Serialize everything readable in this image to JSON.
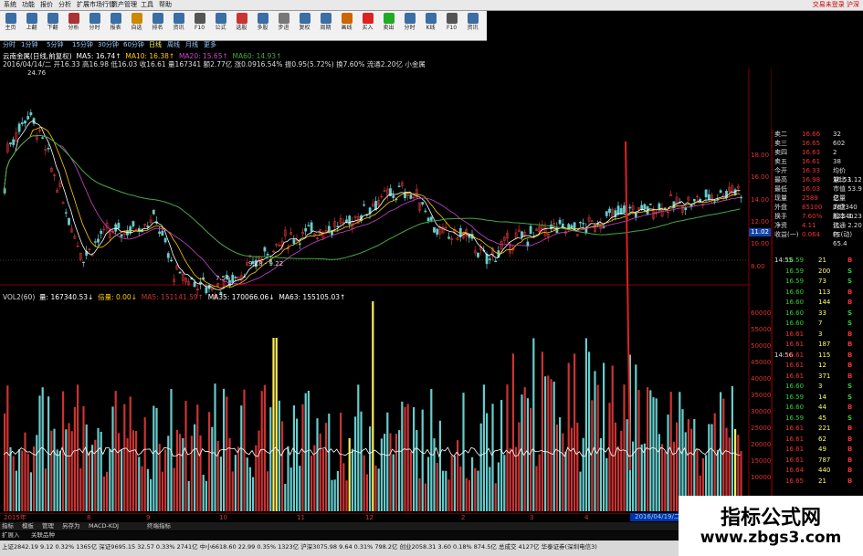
{
  "menu": {
    "items": [
      "系统",
      "功能",
      "报价",
      "分析",
      "扩展市场行情",
      "资产管理",
      "工具",
      "帮助"
    ],
    "right_text": "交易未登录  沪深"
  },
  "toolbar": {
    "buttons": [
      {
        "label": "主页",
        "icon": "home-icon",
        "color": "#3a6ea5"
      },
      {
        "label": "上翻",
        "icon": "up-arrow-icon",
        "color": "#3a6ea5"
      },
      {
        "label": "下翻",
        "icon": "down-arrow-icon",
        "color": "#3a6ea5"
      },
      {
        "label": "分析",
        "icon": "chart-icon",
        "color": "#a33"
      },
      {
        "label": "分时",
        "icon": "clock-icon",
        "color": "#3a6ea5"
      },
      {
        "label": "报表",
        "icon": "table-icon",
        "color": "#3a6ea5"
      },
      {
        "label": "自选",
        "icon": "star-icon",
        "color": "#c80"
      },
      {
        "label": "排名",
        "icon": "rank-icon",
        "color": "#3a6ea5"
      },
      {
        "label": "资讯",
        "icon": "news-icon",
        "color": "#3a6ea5"
      },
      {
        "label": "F10",
        "icon": "f10-icon",
        "color": "#555"
      },
      {
        "label": "公式",
        "icon": "formula-icon",
        "color": "#3a6ea5"
      },
      {
        "label": "选股",
        "icon": "filter-icon",
        "color": "#c33"
      },
      {
        "label": "多股",
        "icon": "grid-icon",
        "color": "#3a6ea5"
      },
      {
        "label": "步进",
        "icon": "step-icon",
        "color": "#777"
      },
      {
        "label": "复权",
        "icon": "adjust-icon",
        "color": "#3a6ea5"
      },
      {
        "label": "周期",
        "icon": "period-icon",
        "color": "#3a6ea5"
      },
      {
        "label": "画线",
        "icon": "pen-icon",
        "color": "#c60"
      },
      {
        "label": "买入",
        "icon": "buy-icon",
        "color": "#d22"
      },
      {
        "label": "卖出",
        "icon": "sell-icon",
        "color": "#2a2"
      },
      {
        "label": "分时",
        "icon": "intraday-icon",
        "color": "#3a6ea5"
      },
      {
        "label": "K线",
        "icon": "kline-icon",
        "color": "#3a6ea5"
      },
      {
        "label": "F10",
        "icon": "f10-icon",
        "color": "#555"
      },
      {
        "label": "资讯",
        "icon": "info-icon",
        "color": "#3a6ea5"
      }
    ]
  },
  "periods": [
    "分时",
    "1分钟",
    "5分钟",
    "15分钟",
    "30分钟",
    "60分钟",
    "日线",
    "周线",
    "月线",
    "更多"
  ],
  "active_period": "日线",
  "chart_header": {
    "title": "云南金属(日线,前复权)",
    "ma5": "MA5: 16.74↑",
    "ma10": "MA10: 16.38↑",
    "ma20": "MA20: 15.65↑",
    "ma60": "MA60: 14.93↑",
    "info_line": "2016/04/14/二  开16.33  高16.98  低16.03  收16.61  量167341  额2.77亿  涨0.0916.54%  振0.95(5.72%)  换7.60%  流通2.20亿  小金属"
  },
  "vol_header": {
    "label": "VOL2(60)",
    "vol": "量: 167340.53↓",
    "multiplier": "倍量: 0.00↓",
    "ma5": "MA5: 151141.59↑",
    "ma35": "MA35: 170066.06↓",
    "ma63": "MA63: 155105.03↑"
  },
  "price_axis": [
    "18.00",
    "16.00",
    "14.00",
    "12.00",
    "10.00",
    "8.00"
  ],
  "price_marker": "11.02",
  "vol_axis": [
    "60000",
    "55000",
    "50000",
    "45000",
    "40000",
    "35000",
    "30000",
    "25000",
    "20000",
    "15000",
    "10000"
  ],
  "chart_labels": {
    "high": "24.76",
    "low": "7.54",
    "range": "9.18 - 9.22"
  },
  "dates": [
    "2015年",
    "8",
    "9",
    "10",
    "11",
    "12",
    "2",
    "3",
    "4"
  ],
  "date_highlight": "2016/04/19/二",
  "quote_panel": {
    "rows": [
      {
        "a": "卖二",
        "b": "16.66",
        "c": "32"
      },
      {
        "a": "卖三",
        "b": "16.65",
        "c": "602"
      },
      {
        "a": "卖四",
        "b": "16.63",
        "c": "2"
      },
      {
        "a": "卖五",
        "b": "16.61",
        "c": "38"
      },
      {
        "a": "今开",
        "b": "16.33",
        "c": "均价 16.53"
      },
      {
        "a": "最高",
        "b": "16.98",
        "c": "量比 1.12"
      },
      {
        "a": "最低",
        "b": "16.03",
        "c": "市值 53.9亿"
      },
      {
        "a": "现量",
        "b": "2589",
        "c": "总量 167340"
      },
      {
        "a": "外盘",
        "b": "85100",
        "c": "内盘 82240"
      },
      {
        "a": "换手",
        "b": "7.60%",
        "c": "股本 3.23亿"
      },
      {
        "a": "净资",
        "b": "4.11",
        "c": "流通 2.20亿"
      },
      {
        "a": "收益(一)",
        "b": "0.064",
        "c": "PE(动) 65.4"
      }
    ],
    "ticks": [
      {
        "t": "14:55",
        "p": "16.59",
        "v": "21",
        "d": "B"
      },
      {
        "t": "",
        "p": "16.59",
        "v": "200",
        "d": "S"
      },
      {
        "t": "",
        "p": "16.59",
        "v": "73",
        "d": "S"
      },
      {
        "t": "",
        "p": "16.60",
        "v": "113",
        "d": "B"
      },
      {
        "t": "",
        "p": "16.60",
        "v": "144",
        "d": "B"
      },
      {
        "t": "",
        "p": "16.60",
        "v": "33",
        "d": "S"
      },
      {
        "t": "",
        "p": "16.60",
        "v": "7",
        "d": "S"
      },
      {
        "t": "",
        "p": "16.61",
        "v": "3",
        "d": "B"
      },
      {
        "t": "",
        "p": "16.61",
        "v": "187",
        "d": "B"
      },
      {
        "t": "14:56",
        "p": "16.61",
        "v": "115",
        "d": "B"
      },
      {
        "t": "",
        "p": "16.61",
        "v": "12",
        "d": "B"
      },
      {
        "t": "",
        "p": "16.61",
        "v": "371",
        "d": "B"
      },
      {
        "t": "",
        "p": "16.60",
        "v": "3",
        "d": "S"
      },
      {
        "t": "",
        "p": "16.59",
        "v": "14",
        "d": "S"
      },
      {
        "t": "",
        "p": "16.60",
        "v": "44",
        "d": "B"
      },
      {
        "t": "",
        "p": "16.59",
        "v": "45",
        "d": "S"
      },
      {
        "t": "",
        "p": "16.61",
        "v": "221",
        "d": "B"
      },
      {
        "t": "",
        "p": "16.61",
        "v": "62",
        "d": "B"
      },
      {
        "t": "",
        "p": "16.61",
        "v": "49",
        "d": "B"
      },
      {
        "t": "",
        "p": "16.61",
        "v": "787",
        "d": "B"
      },
      {
        "t": "",
        "p": "16.64",
        "v": "440",
        "d": "B"
      },
      {
        "t": "",
        "p": "16.65",
        "v": "21",
        "d": "B"
      }
    ]
  },
  "bottom_tabs": [
    "指标",
    "模板",
    "管理",
    "另存为",
    "MACD-KDJ",
    "终端指标"
  ],
  "bottom_tabs2": [
    "扩展入",
    "关联品种"
  ],
  "status_line": "上证2842.19  9.12  0.32%  1365亿  深证9695.15  32.57  0.33%  2741亿  中小6618.60  22.99  0.35%  1323亿  沪深3075.98  9.64  0.31%  798.2亿  创业2058.31  3.60  0.18%  874.5亿  总成交  4127亿  华泰证券(深圳电信3)",
  "watermark": {
    "title": "指标公式网",
    "url": "www.zbgs3.com"
  },
  "colors": {
    "up": "#cc3333",
    "down": "#66cccc",
    "highlight": "#ffee55",
    "ma5": "#ffffff",
    "ma10": "#ffcc00",
    "ma20": "#cc44cc",
    "ma60": "#44aa44"
  }
}
